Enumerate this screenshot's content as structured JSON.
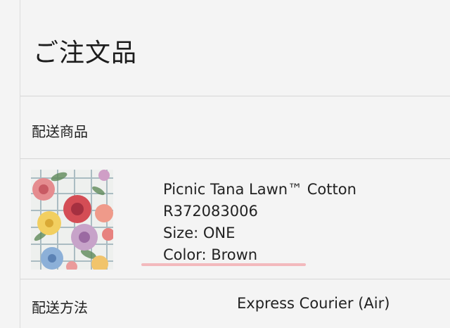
{
  "header": {
    "title": "ご注文品"
  },
  "delivery_items": {
    "label": "配送商品"
  },
  "product": {
    "name": "Picnic Tana Lawn™ Cotton",
    "sku": "R372083006",
    "size": "Size: ONE",
    "color": "Color: Brown"
  },
  "shipping": {
    "label": "配送方法",
    "value": "Express Courier (Air)"
  },
  "colors": {
    "background": "#f4f4f4",
    "underline": "#f3b9bd",
    "divider": "#d6d6d6"
  }
}
